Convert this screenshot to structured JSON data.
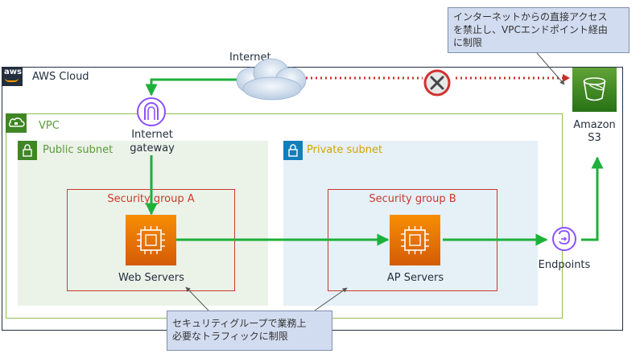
{
  "aws_cloud": {
    "label": "AWS Cloud",
    "logo_text": "aws"
  },
  "vpc": {
    "label": "VPC"
  },
  "public_subnet": {
    "label": "Public subnet"
  },
  "private_subnet": {
    "label": "Private subnet"
  },
  "internet": {
    "label": "Internet"
  },
  "internet_gateway": {
    "label_line1": "Internet",
    "label_line2": "gateway"
  },
  "security_group_a": {
    "label": "Security group A"
  },
  "security_group_b": {
    "label": "Security group B"
  },
  "web_servers": {
    "label": "Web Servers"
  },
  "ap_servers": {
    "label": "AP Servers"
  },
  "endpoints": {
    "label": "Endpoints"
  },
  "s3": {
    "label_line1": "Amazon",
    "label_line2": "S3"
  },
  "callout_top": {
    "line1": "インターネットからの直接アクセス",
    "line2": "を禁止し、VPCエンドポイント経由",
    "line3": "に制限"
  },
  "callout_bottom": {
    "line1": "セキュリティグループで業務上",
    "line2": "必要なトラフィックに制限"
  },
  "colors": {
    "flow_green": "#1db03a",
    "blocked_red": "#c7312a",
    "security_group": "#c93a2e",
    "public_subnet_text": "#5a9a3a",
    "private_subnet_text": "#d3a400",
    "callout_fill": "#d2dcf0"
  }
}
